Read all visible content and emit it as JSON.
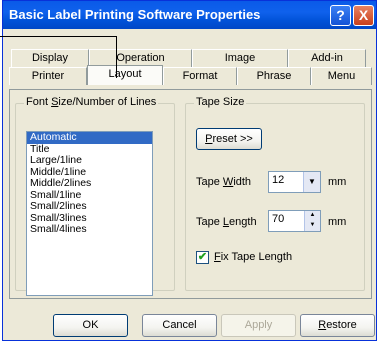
{
  "window": {
    "title": "Basic Label Printing Software Properties",
    "help_label": "?",
    "close_label": "X"
  },
  "tabs": {
    "back_row": [
      "Display",
      "Operation",
      "Image",
      "Add-in"
    ],
    "front_row": [
      "Printer",
      "Layout",
      "Format",
      "Phrase",
      "Menu"
    ],
    "active": "Layout"
  },
  "font_group": {
    "label_pre": "Font ",
    "label_u": "S",
    "label_post": "ize/Number of Lines",
    "items": [
      "Automatic",
      "Title",
      "Large/1line",
      "Middle/1line",
      "Middle/2lines",
      "Small/1line",
      "Small/2lines",
      "Small/3lines",
      "Small/4lines"
    ],
    "selected": "Automatic"
  },
  "tape_group": {
    "label": "Tape Size",
    "preset_u": "P",
    "preset_post": "reset >>",
    "width_pre": "Tape ",
    "width_u": "W",
    "width_post": "idth",
    "width_value": "12",
    "width_unit": "mm",
    "length_pre": "Tape ",
    "length_u": "L",
    "length_post": "ength",
    "length_value": "70",
    "length_unit": "mm",
    "fix_u": "F",
    "fix_post": "ix Tape Length",
    "fix_checked": true
  },
  "buttons": {
    "ok": "OK",
    "cancel": "Cancel",
    "apply": "Apply",
    "restore_u": "R",
    "restore_post": "estore"
  }
}
